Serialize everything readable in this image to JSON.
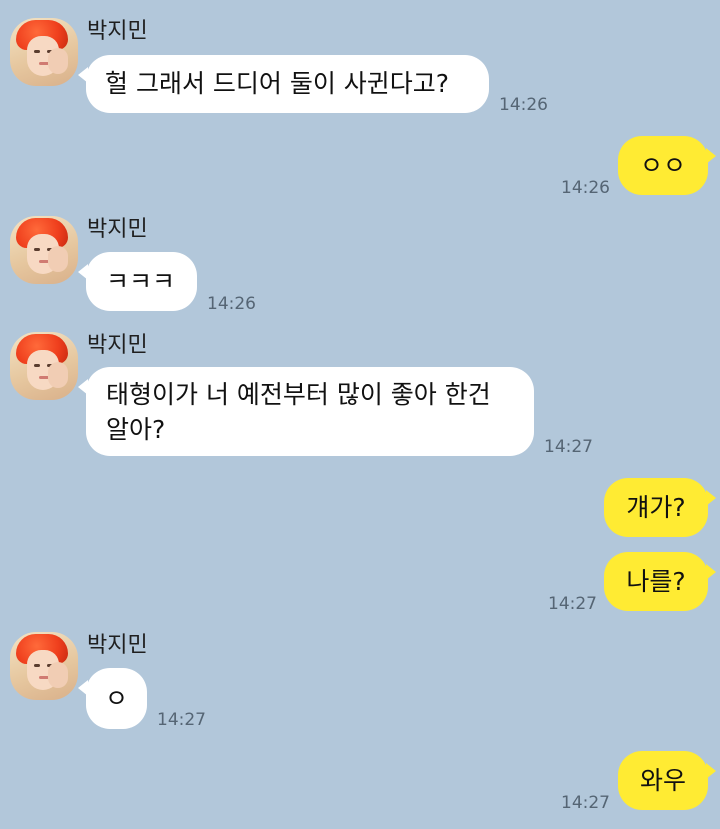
{
  "messages": [
    {
      "sender": "박지민",
      "text": "헐 그래서 드디어 둘이 사귄다고?",
      "time": "14:26"
    },
    {
      "sender": "me",
      "text": "ㅇㅇ",
      "time": "14:26"
    },
    {
      "sender": "박지민",
      "text": "ㅋㅋㅋ",
      "time": "14:26"
    },
    {
      "sender": "박지민",
      "text": "태형이가 너 예전부터 많이 좋아 한건",
      "text_line2": "알아?",
      "time": "14:27"
    },
    {
      "sender": "me",
      "text": "걔가?"
    },
    {
      "sender": "me",
      "text": "나를?",
      "time": "14:27"
    },
    {
      "sender": "박지민",
      "text": "ㅇ",
      "time": "14:27"
    },
    {
      "sender": "me",
      "text": "와우",
      "time": "14:27"
    }
  ],
  "colors": {
    "background": "#b2c7da",
    "outgoing_bubble": "#ffeb33",
    "incoming_bubble": "#ffffff"
  },
  "icons": {
    "avatar": "avatar-icon"
  }
}
